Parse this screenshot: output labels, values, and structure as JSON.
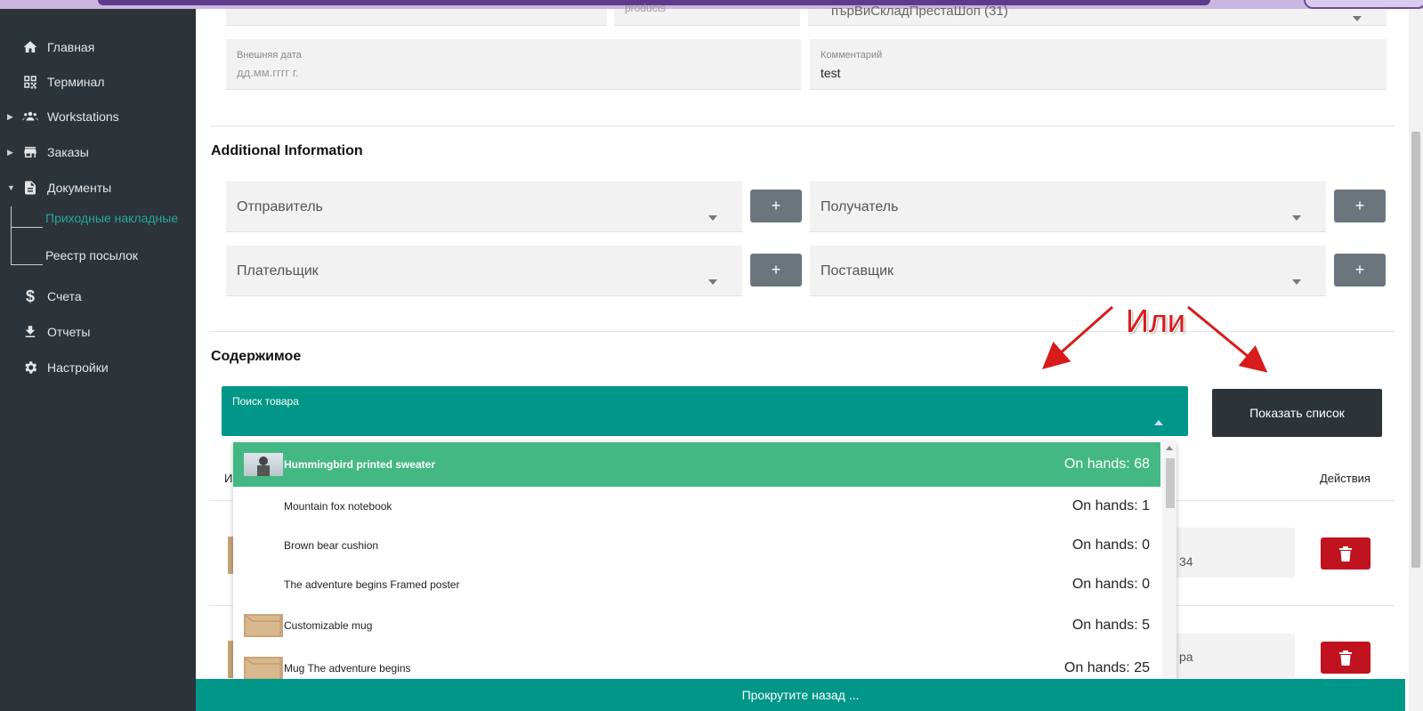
{
  "sidebar": {
    "items": [
      {
        "label": "Главная",
        "icon": "home-icon"
      },
      {
        "label": "Терминал",
        "icon": "qr-icon"
      },
      {
        "label": "Workstations",
        "icon": "people-icon"
      },
      {
        "label": "Заказы",
        "icon": "store-icon"
      },
      {
        "label": "Документы",
        "icon": "document-icon"
      },
      {
        "label": "Счета",
        "icon": "dollar-icon"
      },
      {
        "label": "Отчеты",
        "icon": "download-icon"
      },
      {
        "label": "Настройки",
        "icon": "gear-icon"
      }
    ],
    "sub_items": [
      {
        "label": "Приходные накладные",
        "active": true
      },
      {
        "label": "Реестр посылок",
        "active": false
      }
    ]
  },
  "form": {
    "partial_top_left_label": "products",
    "partial_top_right_value": "пърВиСкладПрестаШоп (31)",
    "external_date_label": "Внешняя дата",
    "external_date_placeholder": "дд.мм.гггг г.",
    "comment_label": "Комментарий",
    "comment_value": "test"
  },
  "additional": {
    "title": "Additional Information",
    "sender": "Отправитель",
    "receiver": "Получатель",
    "payer": "Плательщик",
    "supplier": "Поставщик",
    "plus": "+"
  },
  "contents": {
    "title": "Содержимое",
    "search_label": "Поиск товара",
    "show_list_button": "Показать список",
    "col_left": "И",
    "col_actions": "Действия",
    "row1_value": "34",
    "row2_value": "ра"
  },
  "dropdown": {
    "items": [
      {
        "name": "Hummingbird printed sweater",
        "count": "On hands: 68",
        "active": true
      },
      {
        "name": "Mountain fox notebook",
        "count": "On hands: 1",
        "active": false
      },
      {
        "name": "Brown bear cushion",
        "count": "On hands: 0",
        "active": false
      },
      {
        "name": "The adventure begins Framed poster",
        "count": "On hands: 0",
        "active": false
      },
      {
        "name": "Customizable mug",
        "count": "On hands: 5",
        "active": false
      },
      {
        "name": "Mug The adventure begins",
        "count": "On hands: 25",
        "active": false
      }
    ]
  },
  "annotation": {
    "text": "Или",
    "color": "#d81b1b"
  },
  "footer": {
    "text": "Прокрутите назад ..."
  },
  "colors": {
    "sidebar": "#2c3339",
    "teal": "#009688",
    "active_row": "#43b883",
    "delete": "#c0121f"
  }
}
